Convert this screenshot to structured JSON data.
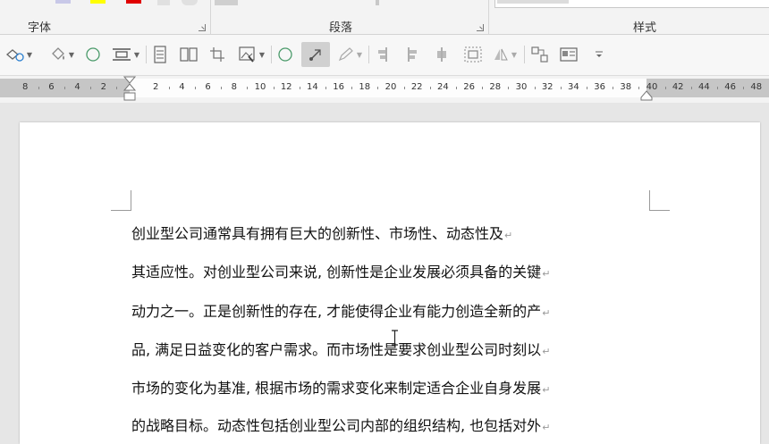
{
  "ribbon": {
    "groups": [
      {
        "label": "字体"
      },
      {
        "label": "段落"
      },
      {
        "label": "样式"
      }
    ]
  },
  "colors": {
    "highlight_yellow": "#ffff00",
    "font_red": "#e00000",
    "ruler_gray": "#c6c6c6",
    "page_white": "#ffffff"
  },
  "toolbar": {
    "icons": [
      "shape-select-icon",
      "shape-fill-icon",
      "ellipse-icon",
      "align-distribute-icon",
      "text-box-icon",
      "columns-icon",
      "crop-icon",
      "picture-icon",
      "ellipse-outline-icon",
      "edit-points-icon",
      "pen-icon",
      "align-left-icon",
      "align-center-icon",
      "align-middle-icon",
      "group-icon",
      "rotate-icon",
      "selection-pane-icon",
      "text-wrap-icon",
      "more-icon"
    ]
  },
  "ruler": {
    "labels": [
      "8",
      "6",
      "4",
      "2",
      "2",
      "4",
      "6",
      "8",
      "10",
      "12",
      "14",
      "16",
      "18",
      "20",
      "22",
      "24",
      "26",
      "28",
      "30",
      "32",
      "34",
      "36",
      "38",
      "40",
      "42",
      "44",
      "46",
      "48"
    ]
  },
  "document": {
    "lines": [
      "创业型公司通常具有拥有巨大的创新性、市场性、动态性及",
      "其适应性。对创业型公司来说, 创新性是企业发展必须具备的关键",
      "动力之一。正是创新性的存在, 才能使得企业有能力创造全新的产",
      "品, 满足日益变化的客户需求。而市场性是要求创业型公司时刻以",
      "市场的变化为基准, 根据市场的需求变化来制定适合企业自身发展",
      "的战略目标。动态性包括创业型公司内部的组织结构, 也包括对外"
    ],
    "paragraph_mark": "↵"
  }
}
